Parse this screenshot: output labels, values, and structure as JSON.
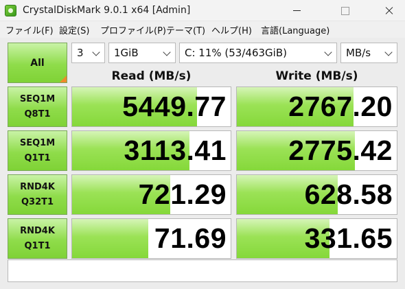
{
  "window": {
    "title": "CrystalDiskMark 9.0.1 x64 [Admin]",
    "icon": "crystaldiskmark-app-icon"
  },
  "menu": [
    "ファイル(F)",
    "設定(S)",
    "プロファイル(P)",
    "テーマ(T)",
    "ヘルプ(H)",
    "言語(Language)"
  ],
  "controls": {
    "all_label": "All",
    "test_count": "3",
    "test_size": "1GiB",
    "drive": "C: 11% (53/463GiB)",
    "unit": "MB/s"
  },
  "headers": {
    "read": "Read (MB/s)",
    "write": "Write (MB/s)"
  },
  "tests": [
    {
      "line1": "SEQ1M",
      "line2": "Q8T1",
      "read": "5449.77",
      "write": "2767.20",
      "read_fill": 0.79,
      "write_fill": 0.73
    },
    {
      "line1": "SEQ1M",
      "line2": "Q1T1",
      "read": "3113.41",
      "write": "2775.42",
      "read_fill": 0.74,
      "write_fill": 0.74
    },
    {
      "line1": "RND4K",
      "line2": "Q32T1",
      "read": "721.29",
      "write": "628.58",
      "read_fill": 0.62,
      "write_fill": 0.63
    },
    {
      "line1": "RND4K",
      "line2": "Q1T1",
      "read": "71.69",
      "write": "331.65",
      "read_fill": 0.48,
      "write_fill": 0.58
    }
  ],
  "status_text": "",
  "colors": {
    "accent_green": "#8fdc4a",
    "corner_orange": "#ef8a2a"
  }
}
